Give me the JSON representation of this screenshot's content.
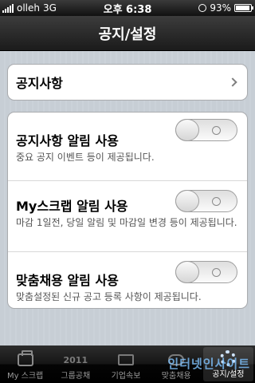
{
  "status_bar": {
    "carrier": "olleh",
    "network": "3G",
    "time": "오후 6:38",
    "battery": "93%",
    "battery_level": 0.93
  },
  "nav": {
    "title": "공지/설정"
  },
  "notice_link": {
    "label": "공지사항"
  },
  "settings": [
    {
      "title": "공지사항 알림 사용",
      "desc": "중요 공지 이벤트 등이 제공됩니다.",
      "enabled": false
    },
    {
      "title": "My스크랩 알림 사용",
      "desc": "마감 1일전, 당일 알림 및 마감일 변경 등이 제공됩니다.",
      "enabled": false
    },
    {
      "title": "맞춤채용 알림 사용",
      "desc": "맞춤설정된 신규 공고 등록 사항이 제공됩니다.",
      "enabled": false
    }
  ],
  "tabs": [
    {
      "label": "My 스크랩",
      "icon": "scrap-box-icon"
    },
    {
      "label": "그룹공채",
      "icon": "2011-icon",
      "icon_text": "2011"
    },
    {
      "label": "기업속보",
      "icon": "breaking-news-icon"
    },
    {
      "label": "맞춤채용",
      "icon": "custom-hire-icon"
    },
    {
      "label": "공지/설정",
      "icon": "settings-gear-icon",
      "active": true
    }
  ],
  "watermark": "인터넷인사이트"
}
